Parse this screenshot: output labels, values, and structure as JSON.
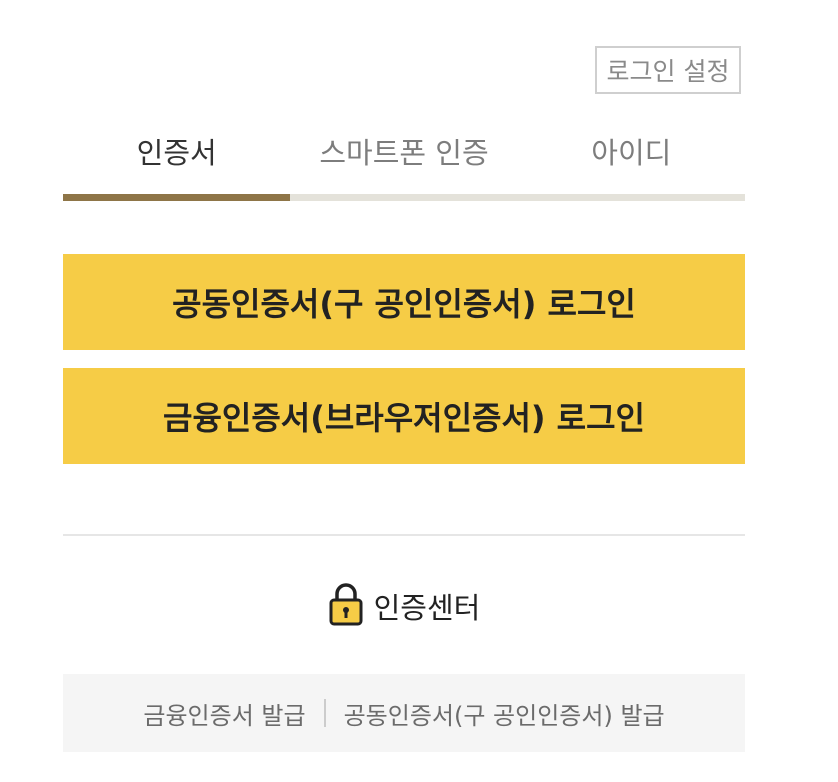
{
  "header": {
    "settings_label": "로그인 설정"
  },
  "tabs": [
    {
      "label": "인증서",
      "active": true
    },
    {
      "label": "스마트폰 인증",
      "active": false
    },
    {
      "label": "아이디",
      "active": false
    }
  ],
  "buttons": {
    "joint_cert_login": "공동인증서(구 공인인증서) 로그인",
    "financial_cert_login": "금융인증서(브라우저인증서) 로그인"
  },
  "cert_center": {
    "icon": "padlock-icon",
    "label": "인증센터"
  },
  "issue_links": {
    "financial_issue": "금융인증서 발급",
    "joint_issue": "공동인증서(구 공인인증서) 발급"
  },
  "colors": {
    "accent_yellow": "#f6cc46",
    "tab_indicator": "#8e7547",
    "tab_track": "#e4e2da"
  }
}
